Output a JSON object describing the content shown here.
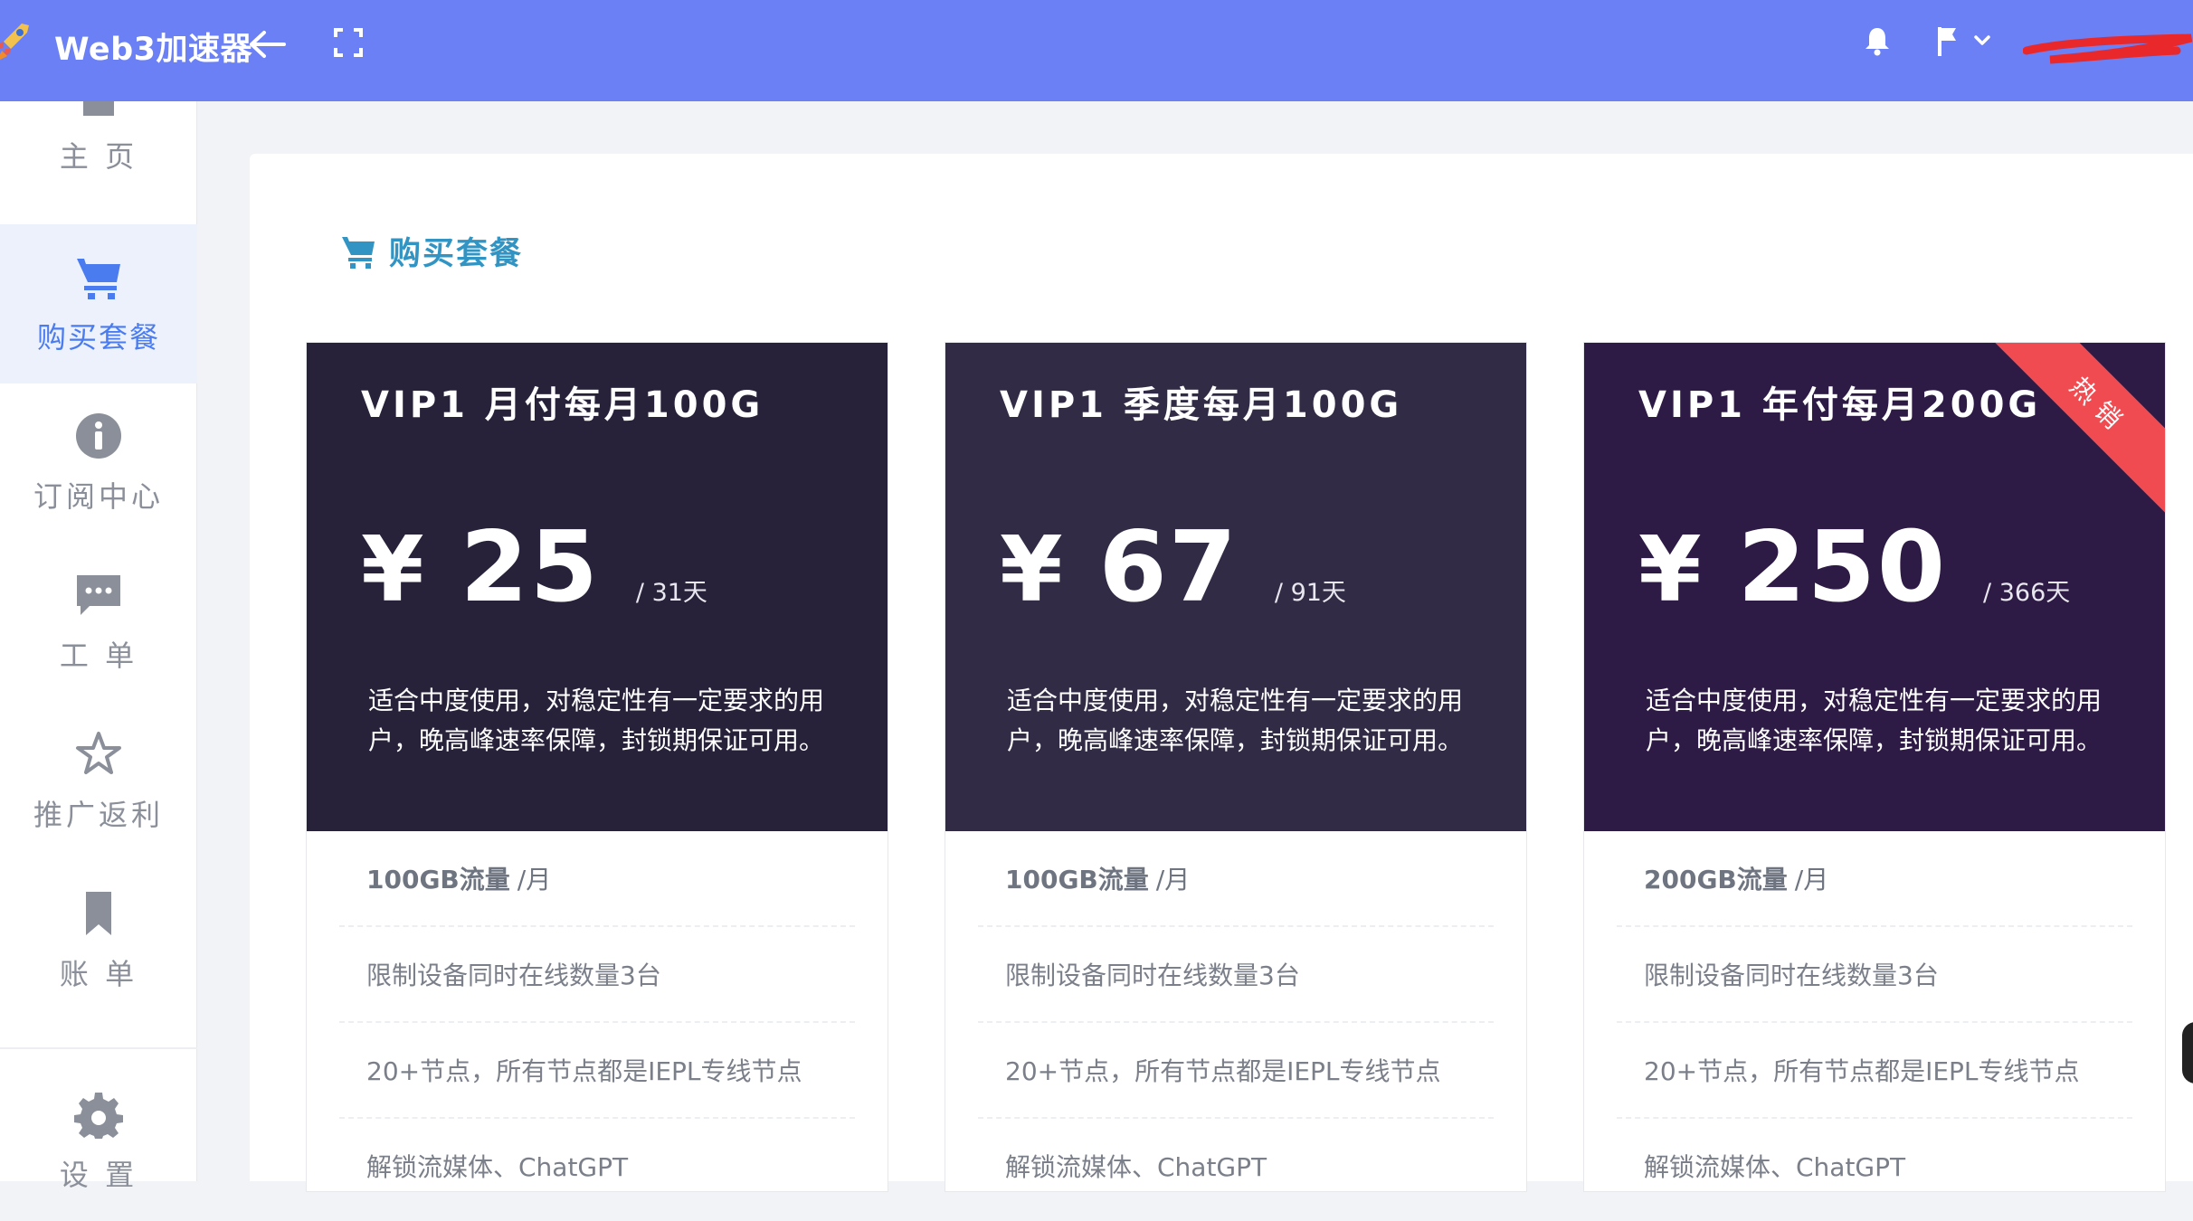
{
  "app": {
    "name": "Web3加速器",
    "user": ""
  },
  "colors": {
    "topbar": "#6a80f4",
    "accent": "#4a7cf0",
    "title": "#3194c3",
    "ribbon": "#f04b51"
  },
  "sidebar": {
    "items": [
      {
        "label": "主 页",
        "icon": "home-icon"
      },
      {
        "label": "购买套餐",
        "icon": "cart-icon",
        "active": true
      },
      {
        "label": "订阅中心",
        "icon": "info-icon"
      },
      {
        "label": "工 单",
        "icon": "chat-icon"
      },
      {
        "label": "推广返利",
        "icon": "star-icon"
      },
      {
        "label": "账 单",
        "icon": "bookmark-icon"
      },
      {
        "label": "设 置",
        "icon": "gear-icon"
      }
    ]
  },
  "page": {
    "title": "购买套餐"
  },
  "plans": [
    {
      "name": "VIP1 月付每月100G",
      "currency": "¥",
      "price": "25",
      "period": "/ 31天",
      "description": "适合中度使用，对稳定性有一定要求的用户，晚高峰速率保障，封锁期保证可用。",
      "features": [
        "100GB流量",
        "/月",
        "限制设备同时在线数量3台",
        "20+节点，所有节点都是IEPL专线节点",
        "解锁流媒体、ChatGPT"
      ],
      "head_color": "#27223a"
    },
    {
      "name": "VIP1 季度每月100G",
      "currency": "¥",
      "price": "67",
      "period": "/ 91天",
      "description": "适合中度使用，对稳定性有一定要求的用户，晚高峰速率保障，封锁期保证可用。",
      "features": [
        "100GB流量",
        "/月",
        "限制设备同时在线数量3台",
        "20+节点，所有节点都是IEPL专线节点",
        "解锁流媒体、ChatGPT"
      ],
      "head_color": "#322b45"
    },
    {
      "name": "VIP1 年付每月200G",
      "currency": "¥",
      "price": "250",
      "period": "/ 366天",
      "description": "适合中度使用，对稳定性有一定要求的用户，晚高峰速率保障，封锁期保证可用。",
      "features": [
        "200GB流量",
        "/月",
        "限制设备同时在线数量3台",
        "20+节点，所有节点都是IEPL专线节点",
        "解锁流媒体、ChatGPT"
      ],
      "head_color": "#2d1a45",
      "badge": "热销"
    }
  ]
}
